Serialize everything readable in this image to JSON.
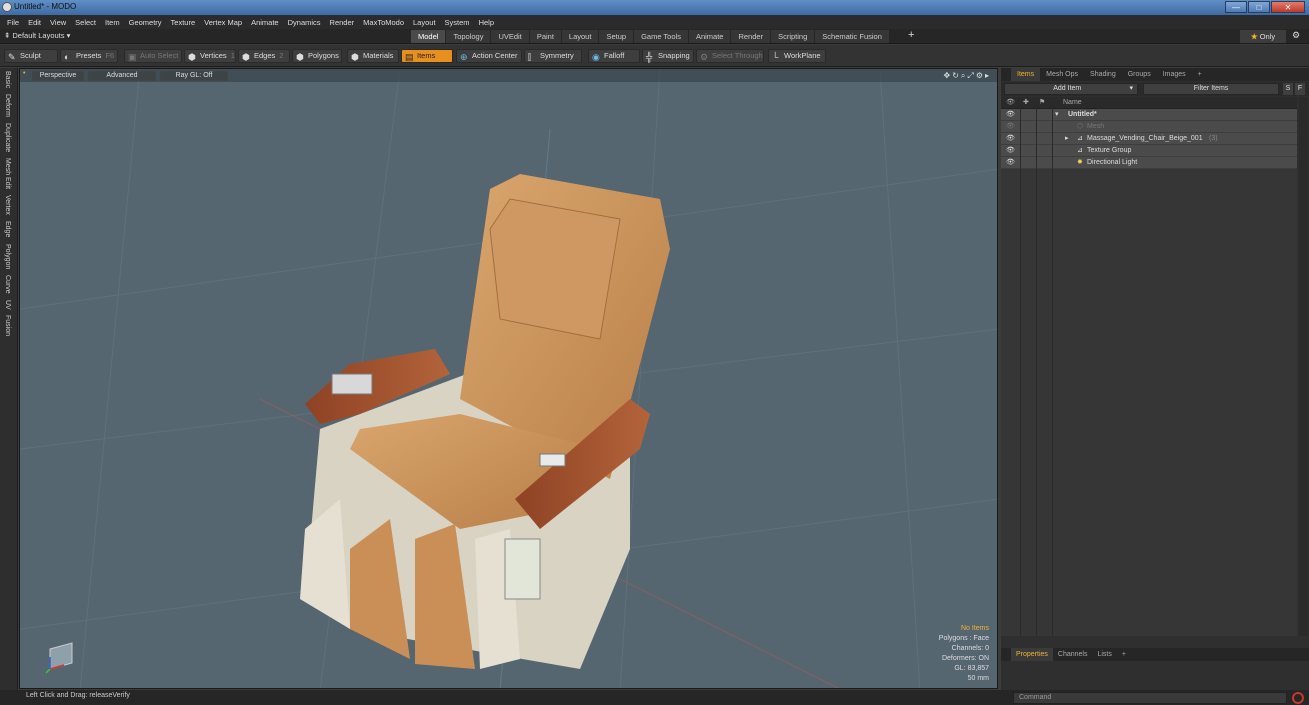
{
  "window": {
    "title": "Untitled* - MODO"
  },
  "menu": [
    "File",
    "Edit",
    "View",
    "Select",
    "Item",
    "Geometry",
    "Texture",
    "Vertex Map",
    "Animate",
    "Dynamics",
    "Render",
    "MaxToModo",
    "Layout",
    "System",
    "Help"
  ],
  "layout": {
    "name": "Default Layouts ▾",
    "tabs": [
      "Model",
      "Topology",
      "UVEdit",
      "Paint",
      "Layout",
      "Setup",
      "Game Tools",
      "Animate",
      "Render",
      "Scripting",
      "Schematic Fusion"
    ],
    "active_tab": "Model",
    "only_label": "Only"
  },
  "toolbar": {
    "sculpt": "Sculpt",
    "presets": "Presets",
    "presets_key": "F6",
    "auto_select": "Auto Select",
    "vertices": "Vertices",
    "vertices_key": "1",
    "edges": "Edges",
    "edges_key": "2",
    "polygons": "Polygons",
    "materials": "Materials",
    "items": "Items",
    "action_center": "Action Center",
    "symmetry": "Symmetry",
    "falloff": "Falloff",
    "snapping": "Snapping",
    "select_through": "Select Through",
    "workplane": "WorkPlane"
  },
  "left_tabs": [
    "Basic",
    "Deform",
    "Duplicate",
    "Mesh Edit",
    "Vertex",
    "Edge",
    "Polygon",
    "Curve",
    "UV",
    "Fusion"
  ],
  "viewport": {
    "view": "Perspective",
    "shading": "Advanced",
    "raygl": "Ray GL: Off",
    "info": {
      "no_items": "No Items",
      "polygons": "Polygons : Face",
      "channels": "Channels: 0",
      "deformers": "Deformers: ON",
      "gl": "GL: 83,857",
      "scale": "50 mm"
    },
    "colors": {
      "background": "#566670",
      "leather": "#c9925a",
      "wood": "#a5532e",
      "plastic": "#d9d3c4"
    }
  },
  "right_panel": {
    "tabs": [
      "Items",
      "Mesh Ops",
      "Shading",
      "Groups",
      "Images",
      "+"
    ],
    "active_tab": "Items",
    "add_item": "Add Item",
    "filter": "Filter Items",
    "s": "S",
    "f": "F",
    "column_name": "Name",
    "items": [
      {
        "label": "Untitled*",
        "level": 0
      },
      {
        "label": "Mesh",
        "level": 1,
        "dim": true
      },
      {
        "label": "Massage_Vending_Chair_Beige_001",
        "count": "(3)",
        "level": 1
      },
      {
        "label": "Texture Group",
        "level": 1
      },
      {
        "label": "Directional Light",
        "level": 1
      }
    ]
  },
  "bottom_panel": {
    "tabs": [
      "Properties",
      "Channels",
      "Lists",
      "+"
    ],
    "active_tab": "Properties"
  },
  "status": {
    "text": "Left Click and Drag:  releaseVerify",
    "command_placeholder": "Command"
  }
}
